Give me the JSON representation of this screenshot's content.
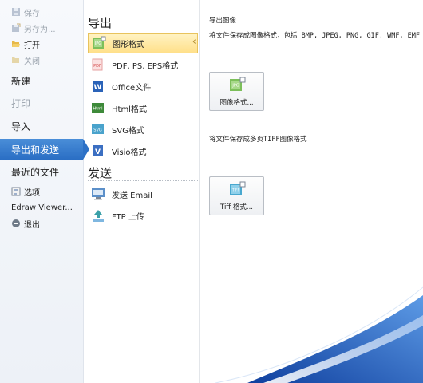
{
  "nav": {
    "save": "保存",
    "save_as": "另存为...",
    "open": "打开",
    "close": "关闭",
    "new": "新建",
    "print": "打印",
    "import": "导入",
    "export_send": "导出和发送",
    "recent": "最近的文件",
    "options": "选项",
    "edraw_viewer": "Edraw Viewer...",
    "exit": "退出"
  },
  "middle": {
    "export_heading": "导出",
    "send_heading": "发送",
    "export_items": [
      {
        "label": "图形格式",
        "icon": "jpg-icon"
      },
      {
        "label": "PDF, PS, EPS格式",
        "icon": "pdf-icon"
      },
      {
        "label": "Office文件",
        "icon": "word-icon"
      },
      {
        "label": "Html格式",
        "icon": "html-icon"
      },
      {
        "label": "SVG格式",
        "icon": "svg-icon"
      },
      {
        "label": "Visio格式",
        "icon": "visio-icon"
      }
    ],
    "send_items": [
      {
        "label": "发送 Email",
        "icon": "email-icon"
      },
      {
        "label": "FTP 上传",
        "icon": "ftp-upload-icon"
      }
    ]
  },
  "content": {
    "section_title": "导出图像",
    "desc1": "将文件保存成图像格式，包括 BMP, JPEG, PNG, GIF, WMF, EMF",
    "image_button": "图像格式...",
    "desc2": "将文件保存成多页TIFF图像格式",
    "tiff_button": "Tiff 格式..."
  },
  "colors": {
    "selected_nav": "#2a6ec4",
    "selected_item": "#ffe08a",
    "swoosh": "#1e5bbf"
  }
}
